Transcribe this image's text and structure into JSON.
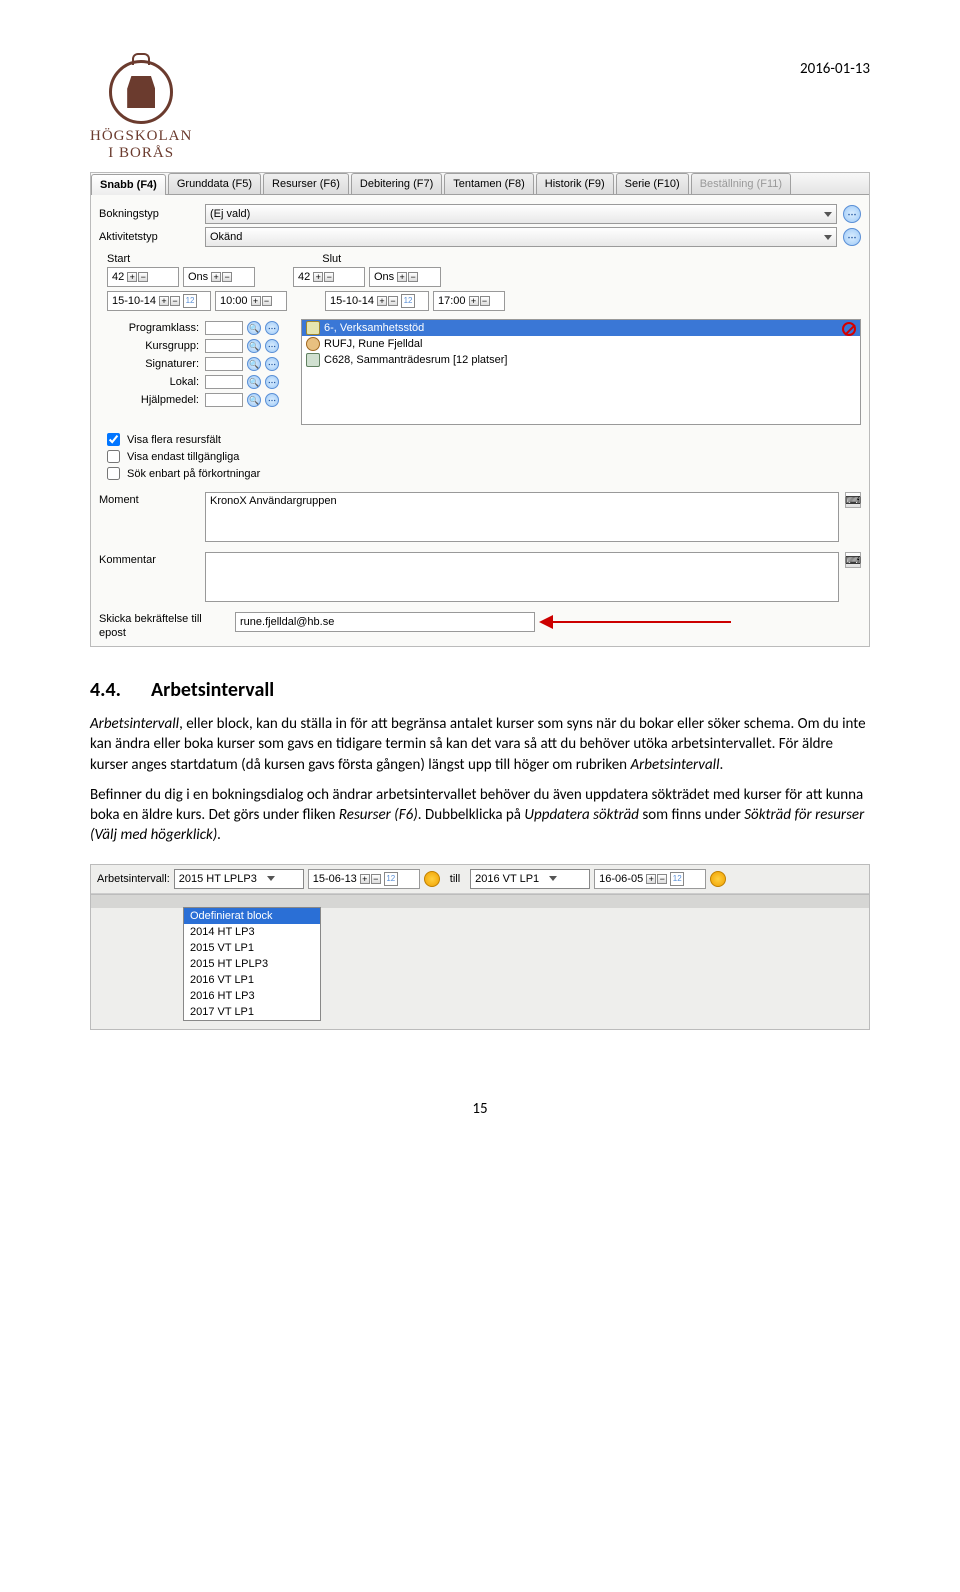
{
  "header": {
    "date": "2016-01-13",
    "logo_line1": "HÖGSKOLAN",
    "logo_line2": "I BORÅS"
  },
  "tabs": [
    {
      "label": "Snabb (F4)",
      "active": true
    },
    {
      "label": "Grunddata (F5)"
    },
    {
      "label": "Resurser (F6)"
    },
    {
      "label": "Debitering (F7)"
    },
    {
      "label": "Tentamen (F8)"
    },
    {
      "label": "Historik (F9)"
    },
    {
      "label": "Serie (F10)"
    },
    {
      "label": "Beställning (F11)",
      "disabled": true
    }
  ],
  "form": {
    "bokningstyp_label": "Bokningstyp",
    "bokningstyp_value": "(Ej vald)",
    "aktivitetstyp_label": "Aktivitetstyp",
    "aktivitetstyp_value": "Okänd",
    "start_label": "Start",
    "slut_label": "Slut",
    "start": {
      "week": "42",
      "day": "Ons",
      "date": "15-10-14",
      "time": "10:00"
    },
    "slut": {
      "week": "42",
      "day": "Ons",
      "date": "15-10-14",
      "time": "17:00"
    }
  },
  "resources": {
    "labels": [
      "Programklass:",
      "Kursgrupp:",
      "Signaturer:",
      "Lokal:",
      "Hjälpmedel:"
    ],
    "items": [
      {
        "icon": "doc",
        "text": "6-, Verksamhetsstöd",
        "selected": true
      },
      {
        "icon": "user",
        "text": "RUFJ, Rune Fjelldal"
      },
      {
        "icon": "room",
        "text": "C628, Sammanträdesrum [12 platser]"
      }
    ]
  },
  "checks": [
    {
      "label": "Visa flera resursfält",
      "checked": true
    },
    {
      "label": "Visa endast tillgängliga",
      "checked": false
    },
    {
      "label": "Sök enbart på förkortningar",
      "checked": false
    }
  ],
  "moment": {
    "label": "Moment",
    "value": "KronoX Användargruppen"
  },
  "kommentar": {
    "label": "Kommentar",
    "value": ""
  },
  "email": {
    "label": "Skicka bekräftelse till epost",
    "value": "rune.fjelldal@hb.se"
  },
  "section": {
    "number": "4.4.",
    "title": "Arbetsintervall",
    "p1_a": "Arbetsintervall",
    "p1_b": ", eller block, kan du ställa in för att begränsa antalet kurser som syns när du bokar eller söker schema. Om du inte kan ändra eller boka kurser som gavs en tidigare termin så kan det vara så att du behöver utöka arbetsintervallet. För äldre kurser anges startdatum (då kursen gavs första gången) längst upp till höger om rubriken ",
    "p1_c": "Arbetsintervall",
    "p1_d": ".",
    "p2_a": "Befinner du dig i en bokningsdialog och ändrar arbetsintervallet behöver du även uppdatera sökträdet med kurser för att kunna boka en äldre kurs. Det görs under fliken ",
    "p2_b": "Resurser (F6)",
    "p2_c": ". Dubbelklicka på ",
    "p2_d": "Uppdatera sökträd",
    "p2_e": " som finns under ",
    "p2_f": "Sökträd för resurser (Välj med högerklick).",
    "p2_g": ""
  },
  "intervalbar": {
    "label": "Arbetsintervall:",
    "from_sel": "2015 HT LPLP3",
    "from_date": "15-06-13",
    "till_label": "till",
    "to_sel": "2016 VT LP1",
    "to_date": "16-06-05",
    "options": [
      "Odefinierat block",
      "2014 HT LP3",
      "2015 VT LP1",
      "2015 HT LPLP3",
      "2016 VT LP1",
      "2016 HT LP3",
      "2017 VT LP1"
    ]
  },
  "page_number": "15"
}
